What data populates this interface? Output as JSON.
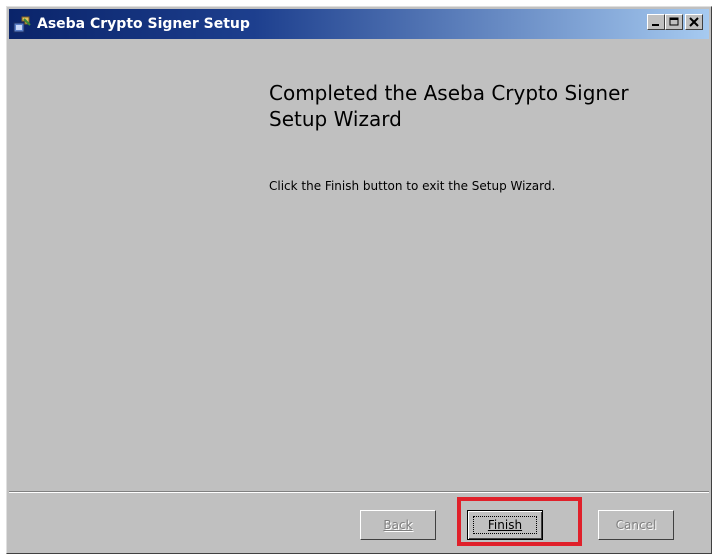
{
  "window": {
    "title": "Aseba Crypto Signer Setup",
    "icon": "installer-icon",
    "controls": {
      "minimize_icon": "minimize-icon",
      "maximize_icon": "maximize-icon",
      "close_icon": "close-icon"
    }
  },
  "content": {
    "heading": "Completed the Aseba Crypto Signer Setup Wizard",
    "message": "Click the Finish button to exit the Setup Wizard."
  },
  "buttons": {
    "back": "Back",
    "finish": "Finish",
    "cancel": "Cancel"
  },
  "highlight": {
    "target": "finish-button",
    "color": "#e0202a"
  }
}
